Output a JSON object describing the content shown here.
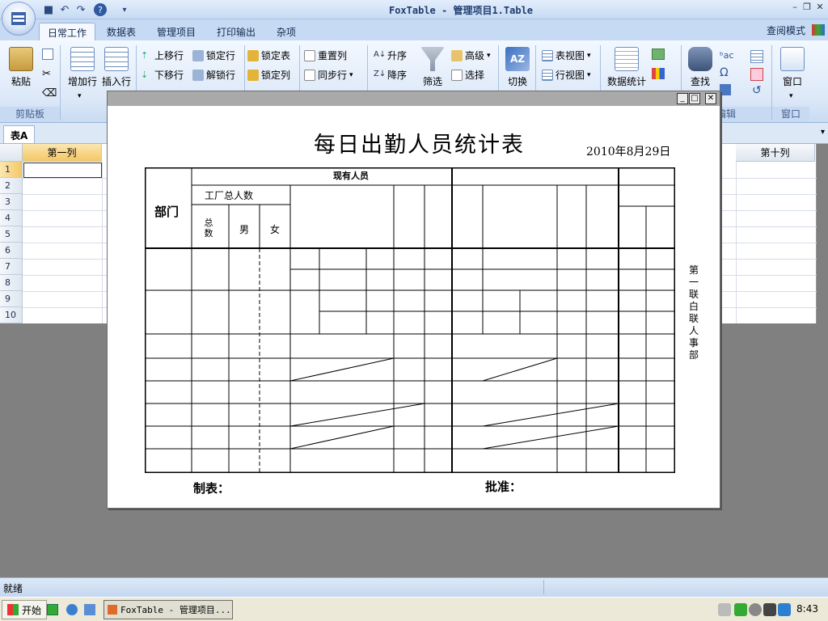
{
  "window": {
    "title": "FoxTable - 管理项目1.Table"
  },
  "tabs": [
    "日常工作",
    "数据表",
    "管理项目",
    "打印输出",
    "杂项"
  ],
  "view_mode": "查阅模式",
  "ribbon": {
    "paste": "粘贴",
    "add_row": "增加行",
    "insert_row": "插入行",
    "move_up": "上移行",
    "move_down": "下移行",
    "lock_row": "锁定行",
    "unlock_row": "解锁行",
    "lock_table": "锁定表",
    "lock_col": "锁定列",
    "reset_col": "重置列",
    "sync_row": "同步行",
    "asc": "升序",
    "desc": "降序",
    "filter": "筛选",
    "advanced": "高级",
    "select": "选择",
    "switch": "切换",
    "table_view": "表视图",
    "row_view": "行视图",
    "stats": "数据统计",
    "find": "查找",
    "window": "窗口",
    "groups": {
      "clipboard": "剪贴板",
      "edit": "编辑",
      "window": "窗口"
    }
  },
  "sheet": {
    "tab": "表A",
    "col_first": "第一列",
    "col_tenth": "第十列",
    "rows": [
      "1",
      "2",
      "3",
      "4",
      "5",
      "6",
      "7",
      "8",
      "9",
      "10"
    ]
  },
  "form": {
    "title": "每日出勤人员统计表",
    "date": "2010年8月29日",
    "header_existing": "现有人员",
    "header_dept": "部门",
    "header_factory_total": "工厂总人数",
    "header_total": "总数",
    "header_male": "男",
    "header_female": "女",
    "side_note": "第一联白联人事部",
    "maker": "制表：",
    "approve": "批准："
  },
  "status": {
    "text": "就绪"
  },
  "taskbar": {
    "start": "开始",
    "task": "FoxTable - 管理项目...",
    "clock": "8:43"
  }
}
